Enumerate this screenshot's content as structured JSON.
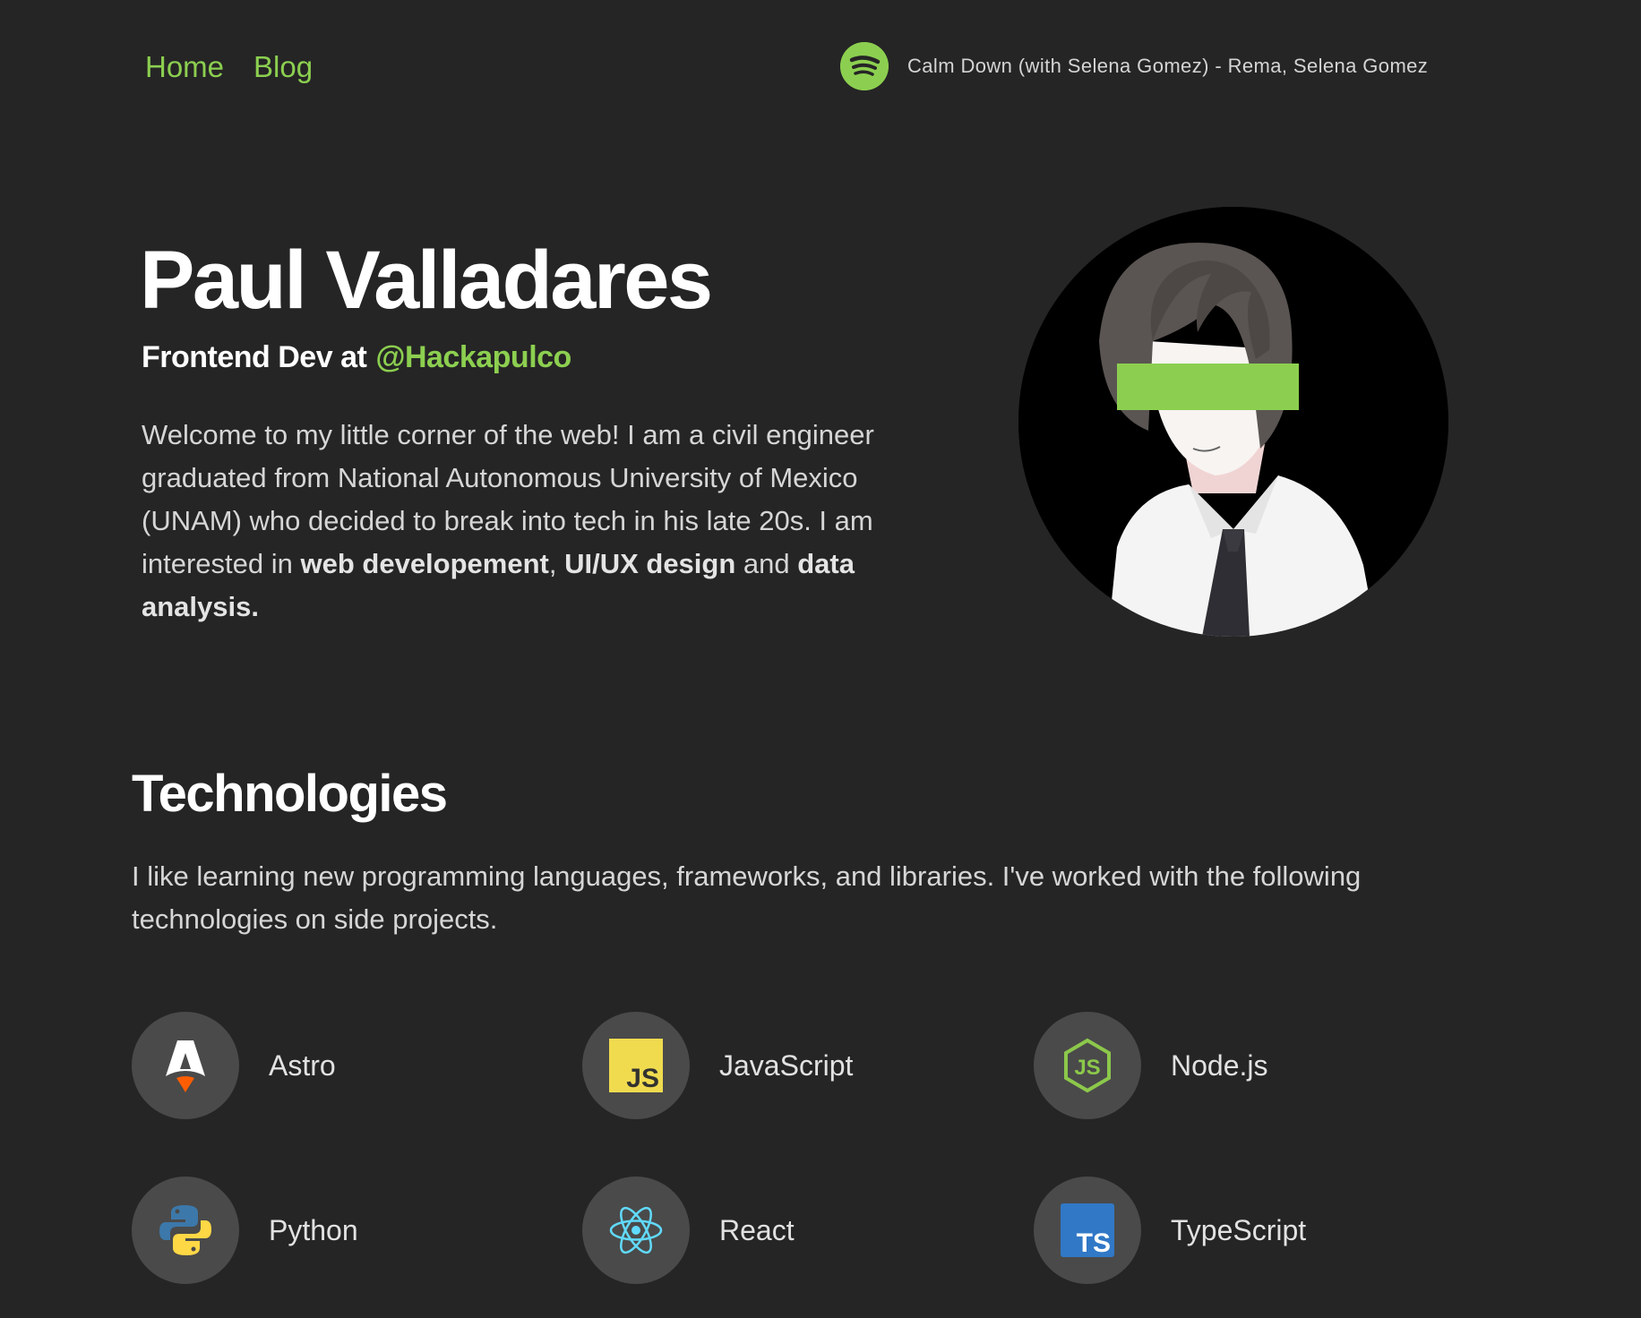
{
  "nav": {
    "links": [
      "Home",
      "Blog"
    ]
  },
  "now_playing": {
    "icon": "spotify-icon",
    "track": "Calm Down (with Selena Gomez) - Rema, Selena Gomez"
  },
  "hero": {
    "name": "Paul Valladares",
    "role": "Frontend Dev at",
    "company": "@Hackapulco",
    "bio": {
      "intro": "Welcome to my little corner of the web! I am a civil engineer graduated from National Autonomous University of Mexico (UNAM) who decided to break into tech in his late 20s. I am interested in ",
      "interest_1": "web developement",
      "sep_1": ", ",
      "interest_2": "UI/UX design",
      "sep_2": " and ",
      "interest_3": "data analysis",
      "end": "."
    }
  },
  "technologies": {
    "title": "Technologies",
    "description": "I like learning new programming languages, frameworks, and libraries. I've worked with the following technologies on side projects.",
    "items": [
      {
        "label": "Astro",
        "icon": "astro-icon"
      },
      {
        "label": "JavaScript",
        "icon": "javascript-icon"
      },
      {
        "label": "Node.js",
        "icon": "nodejs-icon"
      },
      {
        "label": "Python",
        "icon": "python-icon"
      },
      {
        "label": "React",
        "icon": "react-icon"
      },
      {
        "label": "TypeScript",
        "icon": "typescript-icon"
      }
    ]
  },
  "colors": {
    "background": "#252525",
    "accent": "#8ccf50",
    "tech_circle": "#4a4a4a"
  }
}
